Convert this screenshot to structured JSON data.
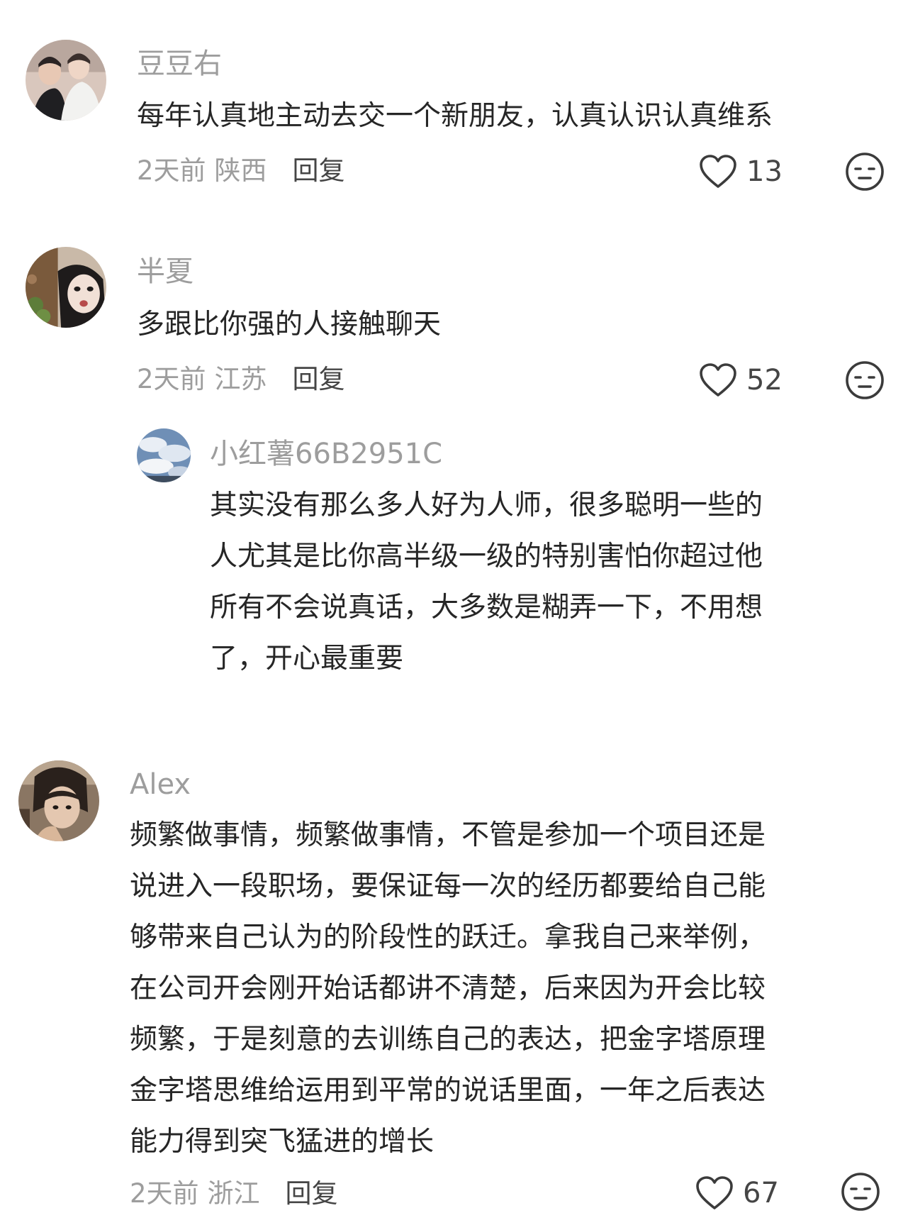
{
  "comments": [
    {
      "username": "豆豆右",
      "lines": [
        "每年认真地主动去交一个新朋友，认真认识认真维系"
      ],
      "time": "2天前",
      "location": "陕西",
      "reply_label": "回复",
      "likes": "13"
    },
    {
      "username": "半夏",
      "lines": [
        "多跟比你强的人接触聊天"
      ],
      "time": "2天前",
      "location": "江苏",
      "reply_label": "回复",
      "likes": "52",
      "replies": [
        {
          "username": "小红薯66B2951C",
          "lines": [
            "其实没有那么多人好为人师，很多聪明一些的",
            "人尤其是比你高半级一级的特别害怕你超过他",
            "所有不会说真话，大多数是糊弄一下，不用想",
            "了，开心最重要"
          ]
        }
      ]
    },
    {
      "username": "Alex",
      "lines": [
        "频繁做事情，频繁做事情，不管是参加一个项目还是",
        "说进入一段职场，要保证每一次的经历都要给自己能",
        "够带来自己认为的阶段性的跃迁。拿我自己来举例，",
        "在公司开会刚开始话都讲不清楚，后来因为开会比较",
        "频繁，于是刻意的去训练自己的表达，把金字塔原理",
        "金字塔思维给运用到平常的说话里面，一年之后表达",
        "能力得到突飞猛进的增长"
      ],
      "time": "2天前",
      "location": "浙江",
      "reply_label": "回复",
      "likes": "67"
    }
  ],
  "icons": {
    "like": "heart-outline-icon",
    "dislike": "neutral-face-icon"
  },
  "colors": {
    "username": "#9d9d9d",
    "text": "#262626",
    "meta": "#9d9d9d",
    "reply": "#454545"
  }
}
